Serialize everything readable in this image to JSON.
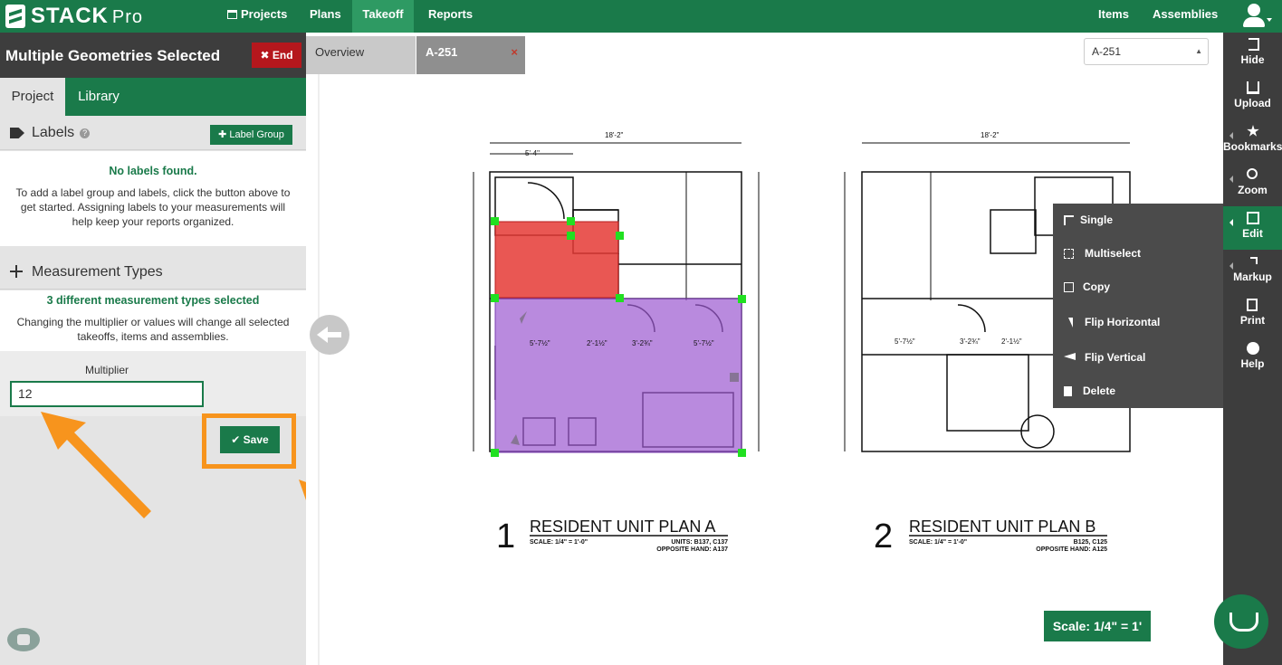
{
  "app": {
    "logo": "STACK",
    "logo_suffix": "Pro"
  },
  "nav": {
    "projects": "Projects",
    "plans": "Plans",
    "takeoff": "Takeoff",
    "reports": "Reports",
    "items": "Items",
    "assemblies": "Assemblies"
  },
  "panel": {
    "title": "Multiple Geometries Selected",
    "end_label": "End",
    "tabs": {
      "project": "Project",
      "library": "Library"
    },
    "labels": {
      "title": "Labels",
      "add_button": "Label Group",
      "empty_title": "No labels found.",
      "empty_text": "To add a label group and labels, click the button above to get started. Assigning labels to your measurements will help keep your reports organized."
    },
    "measurement": {
      "title": "Measurement Types",
      "selected_text": "3 different measurement types selected",
      "note": "Changing the multiplier or values will change all selected takeoffs, items and assemblies."
    },
    "multiplier": {
      "label": "Multiplier",
      "value": "12"
    },
    "save_label": "Save"
  },
  "viewer": {
    "tabs": {
      "overview": "Overview",
      "sheet": "A-251",
      "close": "×"
    },
    "sheet_select": "A-251",
    "plan_a": {
      "number": "1",
      "title": "RESIDENT UNIT PLAN A",
      "scale": "SCALE: 1/4\" = 1'-0\"",
      "units": "UNITS: B137, C137",
      "opposite": "OPPOSITE HAND: A137"
    },
    "plan_b": {
      "number": "2",
      "title": "RESIDENT UNIT PLAN B",
      "scale": "SCALE: 1/4\" = 1'-0\"",
      "units": "B125, C125",
      "opposite": "OPPOSITE HAND: A125"
    },
    "scale_badge": "Scale: 1/4\" = 1'"
  },
  "context_menu": {
    "items": [
      {
        "label": "Single",
        "icon": "cursor-icon"
      },
      {
        "label": "Multiselect",
        "icon": "multiselect-icon"
      },
      {
        "label": "Copy",
        "icon": "copy-icon"
      },
      {
        "label": "Flip Horizontal",
        "icon": "flip-horizontal-icon"
      },
      {
        "label": "Flip Vertical",
        "icon": "flip-vertical-icon"
      },
      {
        "label": "Delete",
        "icon": "trash-icon"
      }
    ]
  },
  "toolbar": {
    "hide": "Hide",
    "upload": "Upload",
    "bookmarks": "Bookmarks",
    "zoom": "Zoom",
    "edit": "Edit",
    "markup": "Markup",
    "print": "Print",
    "help": "Help"
  },
  "colors": {
    "brand": "#1a7a4a",
    "end": "#b5171d",
    "highlight": "#f7941d",
    "area_red": "#e53935",
    "area_purple": "#9b59d0"
  }
}
